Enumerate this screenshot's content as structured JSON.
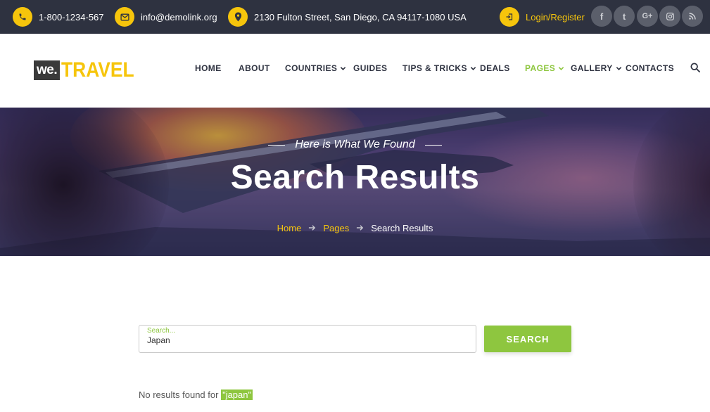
{
  "topbar": {
    "phone": "1-800-1234-567",
    "email": "info@demolink.org",
    "address": "2130 Fulton Street, San Diego, CA 94117-1080 USA",
    "login": "Login/Register",
    "icons": [
      "phone-icon",
      "mail-icon",
      "location-pin-icon",
      "login-icon"
    ],
    "social": [
      {
        "name": "facebook",
        "glyph": "f"
      },
      {
        "name": "twitter",
        "glyph": "t"
      },
      {
        "name": "google-plus",
        "glyph": "G+"
      },
      {
        "name": "instagram",
        "glyph": "◎"
      },
      {
        "name": "rss",
        "glyph": "⟟"
      }
    ]
  },
  "logo": {
    "we": "we.",
    "travel": "TRAVEL"
  },
  "nav": {
    "home": "HOME",
    "about": "ABOUT",
    "countries": "COUNTRIES",
    "guides": "GUIDES",
    "tips": "TIPS & TRICKS",
    "deals": "DEALS",
    "pages": "PAGES",
    "gallery": "GALLERY",
    "contacts": "CONTACTS"
  },
  "hero": {
    "subtitle": "Here is What We Found",
    "title": "Search Results",
    "breadcrumb": {
      "home": "Home",
      "pages": "Pages",
      "current": "Search Results"
    }
  },
  "search": {
    "placeholder": "Search...",
    "value": "Japan",
    "button": "SEARCH"
  },
  "results": {
    "prefix": "No results found for ",
    "term": "japan",
    "quote_open": "\"",
    "quote_close": "\""
  },
  "colors": {
    "accent_yellow": "#f6c50c",
    "accent_green": "#8ec63f",
    "topbar_bg": "#2e3240"
  }
}
